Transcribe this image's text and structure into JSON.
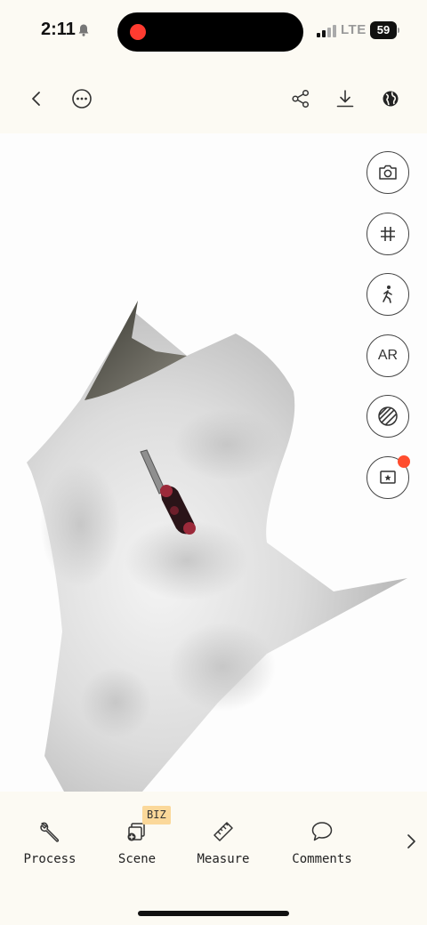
{
  "status_bar": {
    "time": "2:11",
    "network": "LTE",
    "battery": "59",
    "bell_icon": "bell-muted-icon"
  },
  "toolbar": {
    "left": [
      {
        "name": "back-button",
        "icon": "chevron-left-icon"
      },
      {
        "name": "more-button",
        "icon": "ellipsis-circle-icon"
      }
    ],
    "right": [
      {
        "name": "share-button",
        "icon": "share-icon"
      },
      {
        "name": "download-button",
        "icon": "download-icon"
      },
      {
        "name": "globe-button",
        "icon": "globe-icon"
      }
    ]
  },
  "viewer": {
    "side_buttons": [
      {
        "name": "camera-button",
        "icon": "camera-icon"
      },
      {
        "name": "grid-button",
        "icon": "grid-icon"
      },
      {
        "name": "walk-mode-button",
        "icon": "walking-person-icon"
      },
      {
        "name": "ar-button",
        "label": "AR"
      },
      {
        "name": "material-button",
        "icon": "striped-sphere-icon"
      },
      {
        "name": "favorites-button",
        "icon": "star-frame-icon",
        "badge_color": "#ff4d2e"
      }
    ]
  },
  "bottom_tabs": {
    "items": [
      {
        "label": "Process",
        "icon": "wrench-icon"
      },
      {
        "label": "Scene",
        "icon": "scene-add-icon",
        "badge": "BIZ"
      },
      {
        "label": "Measure",
        "icon": "ruler-icon"
      },
      {
        "label": "Comments",
        "icon": "speech-bubble-icon"
      }
    ],
    "more_icon": "chevron-right-icon"
  }
}
